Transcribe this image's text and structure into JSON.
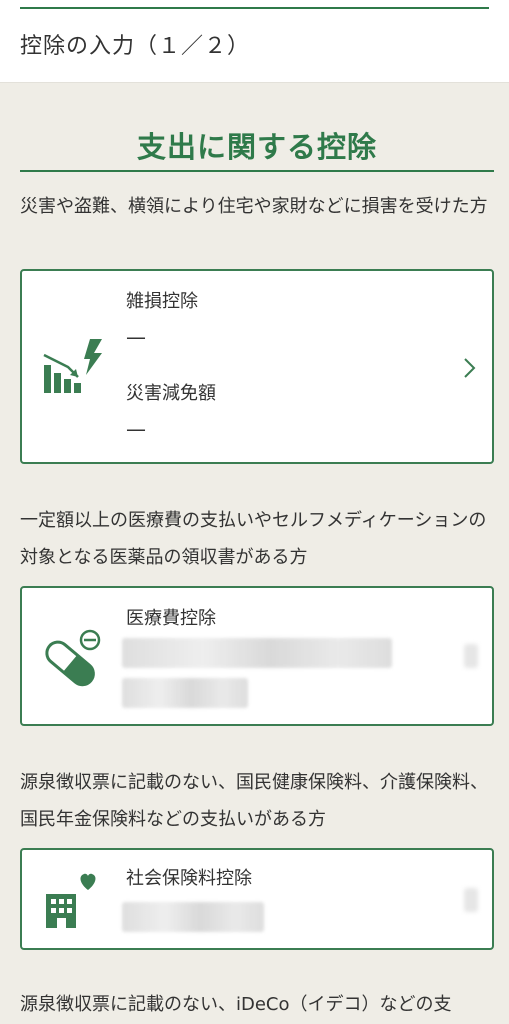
{
  "header": {
    "title": "控除の入力（１／２）"
  },
  "section": {
    "heading": "支出に関する控除"
  },
  "colors": {
    "accent": "#2f7a4a",
    "background": "#efede6",
    "card": "#ffffff"
  },
  "groups": [
    {
      "description": "災害や盗難、横領により住宅や家財などに損害を受けた方",
      "card": {
        "icon": "disaster-chart-icon",
        "items": [
          {
            "label": "雑損控除",
            "value": "—"
          },
          {
            "label": "災害減免額",
            "value": "—"
          }
        ]
      }
    },
    {
      "description": "一定額以上の医療費の支払いやセルフメディケーションの対象となる医薬品の領収書がある方",
      "card": {
        "icon": "medicine-capsule-icon",
        "items": [
          {
            "label": "医療費控除"
          }
        ]
      }
    },
    {
      "description": "源泉徴収票に記載のない、国民健康保険料、介護保険料、国民年金保険料などの支払いがある方",
      "card": {
        "icon": "building-heart-icon",
        "items": [
          {
            "label": "社会保険料控除"
          }
        ]
      }
    },
    {
      "description": "源泉徴収票に記載のない、iDeCo（イデコ）などの支"
    }
  ]
}
